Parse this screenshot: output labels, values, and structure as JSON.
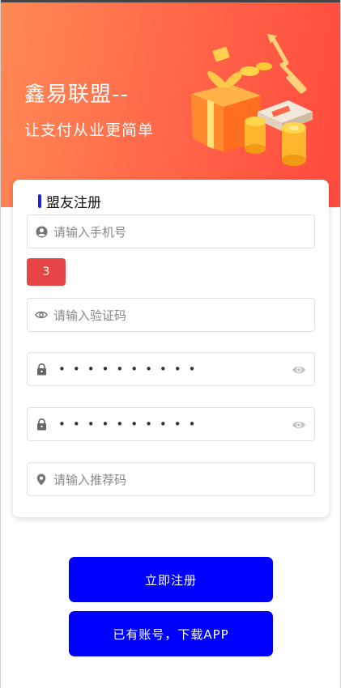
{
  "banner": {
    "title": "鑫易联盟--",
    "subtitle": "让支付从业更简单",
    "gradient_start": "#ff8a55",
    "gradient_end": "#ff4a3e"
  },
  "card": {
    "title": "盟友注册",
    "accent": "#1b20e6"
  },
  "form": {
    "phone_placeholder": "请输入手机号",
    "countdown_value": "3",
    "code_placeholder": "请输入验证码",
    "password_masked": "••••••••••",
    "confirm_password_masked": "••••••••••",
    "referral_placeholder": "请输入推荐码"
  },
  "actions": {
    "register_label": "立即注册",
    "have_account_label": "已有账号，下载APP",
    "button_color": "#0000ff",
    "countdown_color": "#e64545"
  },
  "icons": {
    "phone_field": "user-circle-icon",
    "code_field": "eye-icon",
    "password_field": "lock-icon",
    "password_toggle": "eye-icon",
    "referral_field": "location-pin-icon",
    "banner_art": "gift-coins-illustration"
  }
}
